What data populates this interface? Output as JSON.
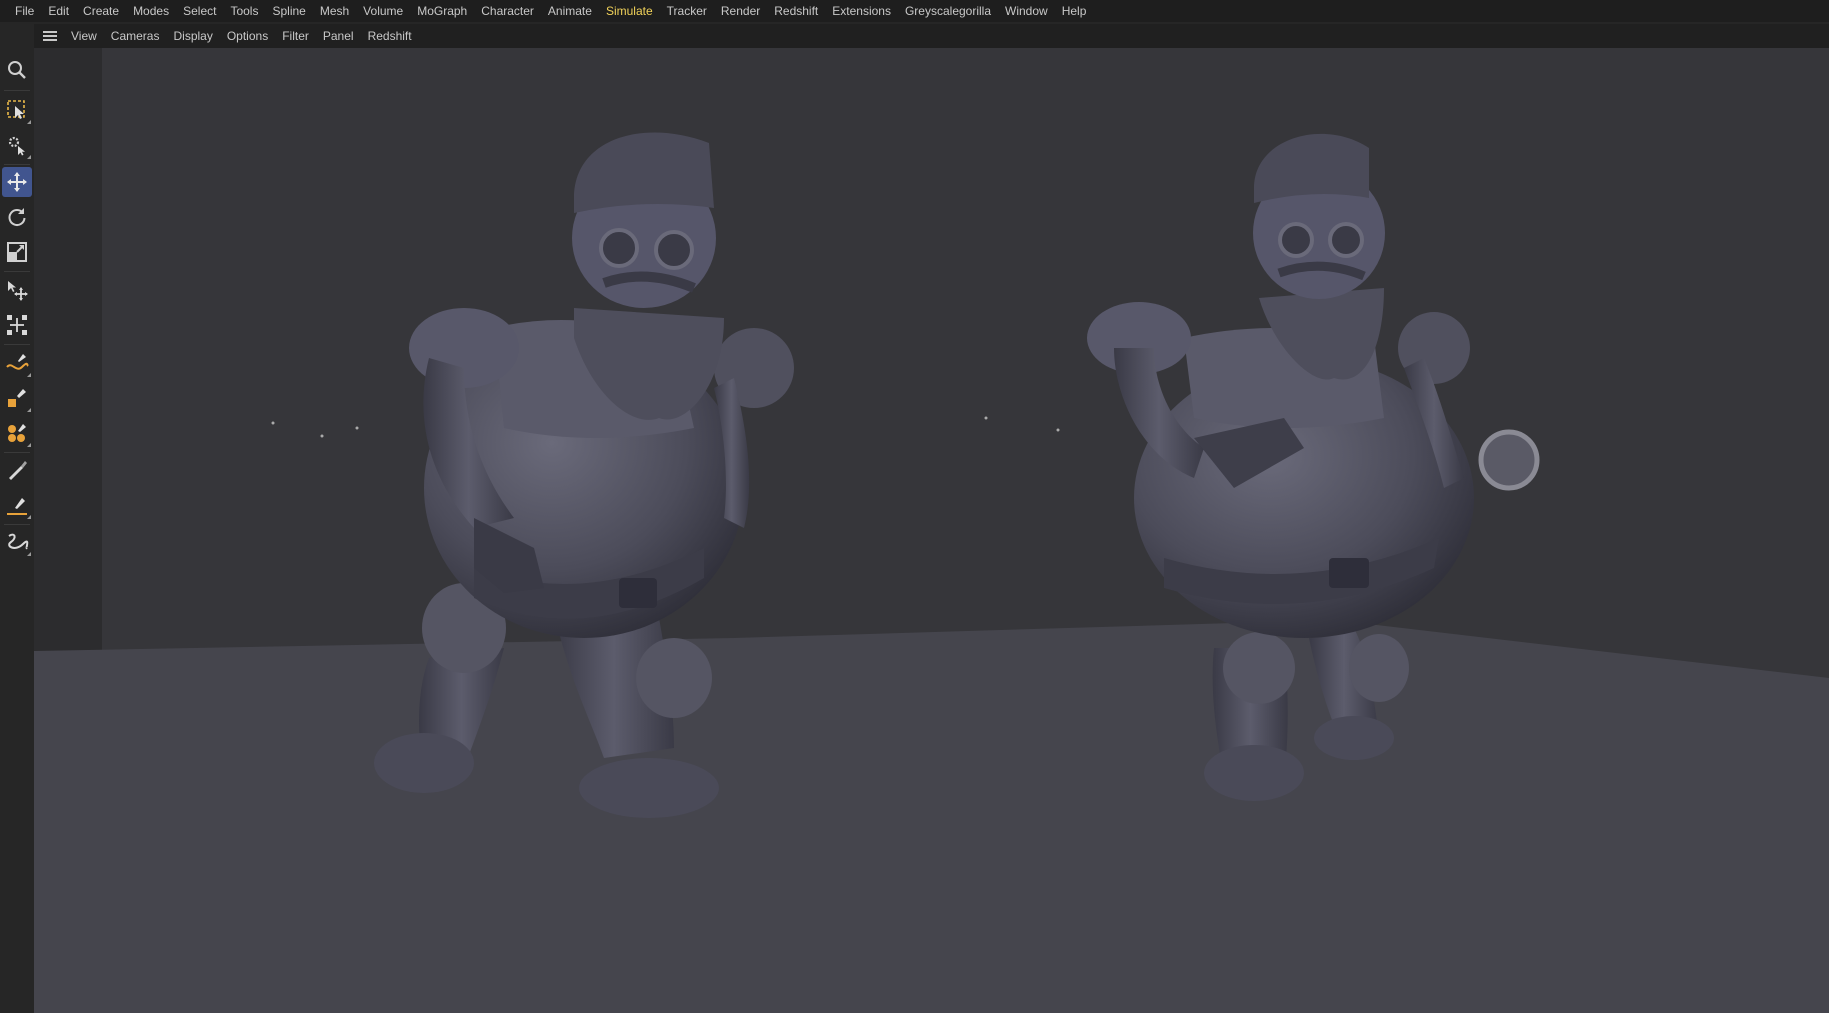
{
  "menubar": {
    "items": [
      {
        "label": "File"
      },
      {
        "label": "Edit"
      },
      {
        "label": "Create"
      },
      {
        "label": "Modes"
      },
      {
        "label": "Select"
      },
      {
        "label": "Tools"
      },
      {
        "label": "Spline"
      },
      {
        "label": "Mesh"
      },
      {
        "label": "Volume"
      },
      {
        "label": "MoGraph"
      },
      {
        "label": "Character"
      },
      {
        "label": "Animate"
      },
      {
        "label": "Simulate"
      },
      {
        "label": "Tracker"
      },
      {
        "label": "Render"
      },
      {
        "label": "Redshift"
      },
      {
        "label": "Extensions"
      },
      {
        "label": "Greyscalegorilla"
      },
      {
        "label": "Window"
      },
      {
        "label": "Help"
      }
    ],
    "active_item": "Simulate",
    "active_color": "#f2d35a"
  },
  "viewport_menu": {
    "items": [
      {
        "label": "View"
      },
      {
        "label": "Cameras"
      },
      {
        "label": "Display"
      },
      {
        "label": "Options"
      },
      {
        "label": "Filter"
      },
      {
        "label": "Panel"
      },
      {
        "label": "Redshift"
      }
    ]
  },
  "toolbar": {
    "tools": [
      {
        "icon": "search-icon"
      },
      {
        "icon": "live-selection-icon"
      },
      {
        "icon": "object-tools-icon"
      },
      {
        "icon": "move-icon",
        "active": true
      },
      {
        "icon": "rotate-icon"
      },
      {
        "icon": "scale-icon"
      },
      {
        "icon": "move-axis-icon"
      },
      {
        "icon": "transform-icon"
      },
      {
        "icon": "spline-pen-icon"
      },
      {
        "icon": "primitive-shape-icon"
      },
      {
        "icon": "generator-icon"
      },
      {
        "icon": "paint-brush-icon"
      },
      {
        "icon": "knife-icon"
      },
      {
        "icon": "sketch-spline-icon"
      }
    ],
    "active_color": "#41558f"
  },
  "viewport": {
    "background_color": "#36363a",
    "floor_color": "#45454d",
    "model_color": "#505060",
    "objects": [
      "santa-robot-left",
      "santa-robot-right"
    ]
  }
}
